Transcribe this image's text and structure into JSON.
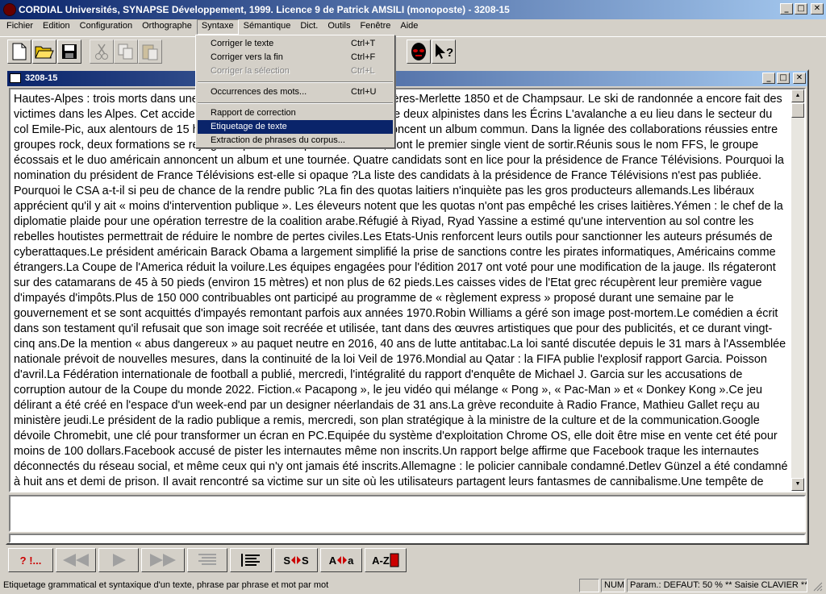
{
  "window": {
    "title": "CORDIAL Universités, SYNAPSE Développement, 1999. Licence 9 de Patrick AMSILI (monoposte) - 3208-15"
  },
  "menubar": [
    "Fichier",
    "Edition",
    "Configuration",
    "Orthographe",
    "Syntaxe",
    "Sémantique",
    "Dict.",
    "Outils",
    "Fenêtre",
    "Aide"
  ],
  "syntaxe_menu": {
    "items": [
      {
        "label": "Corriger le texte",
        "shortcut": "Ctrl+T"
      },
      {
        "label": "Corriger vers la fin",
        "shortcut": "Ctrl+F"
      },
      {
        "label": "Corriger la sélection",
        "shortcut": "Ctrl+L"
      },
      {
        "label": "Occurrences des mots...",
        "shortcut": "Ctrl+U"
      },
      {
        "label": "Rapport de correction",
        "shortcut": ""
      },
      {
        "label": "Etiquetage de texte",
        "shortcut": ""
      },
      {
        "label": "Extraction de phrases du corpus...",
        "shortcut": ""
      }
    ]
  },
  "document": {
    "title": "3208-15",
    "text": "Hautes-Alpes : trois morts dans une avalanche près de la station des Orcières-Merlette 1850 et de Champsaur. Le ski de randonnée a encore fait des victimes dans les Alpes. Cet accident survient deux jours après le décès de deux alpinistes dans les Écrins L'avalanche a eu lieu dans le secteur du col Emile-Pic, aux alentours de 15 heures.Franz Ferdinand et Sparks annoncent un album commun. Dans la lignée des collaborations réussies entre groupes rock, deux formations se rejoignent pour un disque en commun, dont le premier single vient de sortir.Réunis sous le nom FFS, le groupe écossais et le duo américain annoncent un album et une tournée. Quatre candidats sont en lice pour la présidence de France Télévisions. Pourquoi la nomination du président de France Télévisions est-elle si opaque ?La liste des candidats à la présidence de France Télévisions n'est pas publiée. Pourquoi le CSA a-t-il si peu de chance de la rendre public ?La fin des quotas laitiers n'inquiète pas les gros producteurs allemands.Les libéraux apprécient qu'il y ait « moins d'intervention publique ». Les éleveurs notent que les quotas n'ont pas empêché les crises laitières.Yémen : le chef de la diplomatie plaide pour une opération terrestre de la coalition arabe.Réfugié à Riyad, Ryad Yassine a estimé qu'une intervention au sol contre les rebelles houtistes permettrait de réduire le nombre de pertes civiles.Les Etats-Unis renforcent leurs outils pour sanctionner les auteurs présumés de cyberattaques.Le président américain Barack Obama a largement simplifié la prise de sanctions contre les pirates informatiques, Américains comme étrangers.La Coupe de l'America réduit la voilure.Les équipes engagées pour l'édition 2017 ont voté pour une modification de la jauge. Ils régateront sur des catamarans de 45 à 50 pieds (environ 15 mètres) et non plus de 62 pieds.Les caisses vides de l'Etat grec récupèrent leur première vague d'impayés d'impôts.Plus de 150 000 contribuables ont participé au programme de « règlement express » proposé durant une semaine par le gouvernement et se sont acquittés d'impayés remontant parfois aux années 1970.Robin Williams a géré son image post-mortem.Le comédien a écrit dans son testament qu'il refusait que son image soit recréée et utilisée, tant dans des œuvres artistiques que pour des publicités, et ce durant vingt-cinq ans.De la mention « abus dangereux » au paquet neutre en 2016, 40 ans de lutte antitabac.La loi santé discutée depuis le 31 mars à l'Assemblée nationale prévoit de nouvelles mesures, dans la continuité de la loi Veil de 1976.Mondial au Qatar : la FIFA publie l'explosif rapport Garcia. Poisson d'avril.La Fédération internationale de football a publié, mercredi, l'intégralité du rapport d'enquête de Michael J. Garcia sur les accusations de corruption autour de la Coupe du monde 2022. Fiction.« Pacapong », le jeu vidéo qui mélange « Pong », « Pac-Man » et « Donkey Kong ».Ce jeu délirant a été créé en l'espace d'un week-end par un designer néerlandais de 31 ans.La grève reconduite à Radio France, Mathieu Gallet reçu au ministère jeudi.Le président de la radio publique a remis, mercredi, son plan stratégique à la ministre de la culture et de la communication.Google dévoile Chromebit, une clé pour transformer un écran en PC.Equipée du système d'exploitation Chrome OS, elle doit être mise en vente cet été pour moins de 100 dollars.Facebook accusé de pister les internautes même non inscrits.Un rapport belge affirme que Facebook traque les internautes déconnectés du réseau social, et même ceux qui n'y ont jamais été inscrits.Allemagne : le policier cannibale condamné.Detlev Günzel a été condamné à huit ans et demi de prison. Il avait rencontré sa victime sur un site où les utilisateurs partagent leurs fantasmes de cannibalisme.Une tempête de sable s'abat sur une ville du centre de la Chine.Une tempête de sable s'est abattue,  mardi, sur Goldmud, une"
  },
  "bottom_toolbar": {
    "check_label": "? !...",
    "sos_label": "S",
    "sos_label2": "S",
    "aa_label": "A",
    "aa_label2": "a",
    "az_label": "A-Z"
  },
  "status": {
    "message": "Etiquetage grammatical et syntaxique d'un texte, phrase par phrase et mot par mot",
    "num": "NUM",
    "params": "Param.: DEFAUT: 50 % ** Saisie CLAVIER **"
  },
  "colors": {
    "titlebar": "#0a246a",
    "menu_highlight": "#0a246a",
    "face": "#d4d0c8"
  }
}
